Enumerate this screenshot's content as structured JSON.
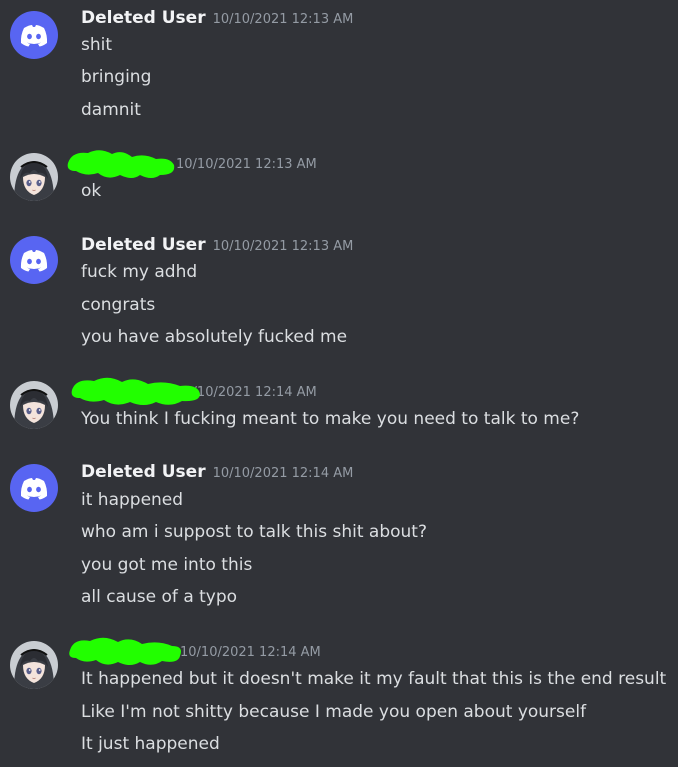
{
  "messages": [
    {
      "username": "Deleted User",
      "timestamp": "10/10/2021 12:13 AM",
      "avatar": "discord-logo",
      "lines": [
        "shit",
        "bringing",
        "damnit"
      ]
    },
    {
      "username": "",
      "timestamp": "10/10/2021 12:13 AM",
      "avatar": "anime-girl",
      "lines": [
        "ok"
      ]
    },
    {
      "username": "Deleted User",
      "timestamp": "10/10/2021 12:13 AM",
      "avatar": "discord-logo",
      "lines": [
        "fuck my adhd",
        "congrats",
        "you have absolutely fucked me"
      ]
    },
    {
      "username": "",
      "timestamp": "10/10/2021 12:14 AM",
      "avatar": "anime-girl",
      "lines": [
        "You think I fucking meant to make you need to talk to me?"
      ]
    },
    {
      "username": "Deleted User",
      "timestamp": "10/10/2021 12:14 AM",
      "avatar": "discord-logo",
      "lines": [
        "it happened",
        "who am i suppost to talk this shit about?",
        "you got me into this",
        "all cause of a typo"
      ]
    },
    {
      "username": "",
      "timestamp": "10/10/2021 12:14 AM",
      "avatar": "anime-girl",
      "lines": [
        "It happened but it doesn't make it my fault that this is the end result",
        "Like I'm not shitty because I made you open about yourself",
        "It just happened"
      ]
    }
  ],
  "colors": {
    "background": "#313338",
    "username": "#f2f3f5",
    "timestamp": "#949ba4",
    "message_text": "#dbdee1",
    "discord_blurple": "#5865f2",
    "redaction_green": "#22ff00"
  }
}
